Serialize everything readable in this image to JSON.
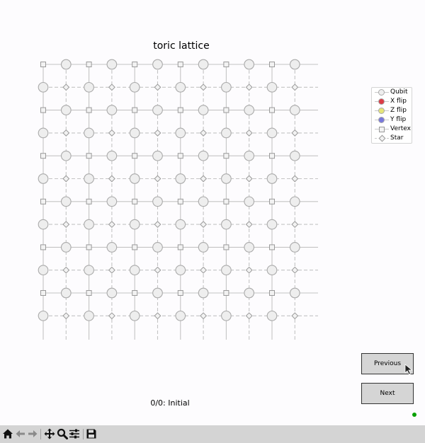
{
  "figure": {
    "title": "toric lattice",
    "status": "0/0: Initial"
  },
  "lattice": {
    "rows": 12,
    "cols": 12
  },
  "legend": {
    "items": [
      {
        "label": "Qubit",
        "marker": "circle",
        "fill": "#eeeeee",
        "line": "solid"
      },
      {
        "label": "X flip",
        "marker": "circle",
        "fill": "#dc3c46",
        "line": "solid"
      },
      {
        "label": "Z flip",
        "marker": "circle",
        "fill": "#e6e678",
        "line": "solid"
      },
      {
        "label": "Y flip",
        "marker": "circle",
        "fill": "#7878dc",
        "line": "solid"
      },
      {
        "label": "Vertex",
        "marker": "square",
        "fill": "#f2f2f2",
        "line": "solid"
      },
      {
        "label": "Star",
        "marker": "diamond",
        "fill": "#f2f2f2",
        "line": "dashed"
      }
    ]
  },
  "buttons": {
    "previous": "Previous",
    "next": "Next"
  },
  "colors": {
    "qubit_fill": "#eeeeee",
    "qubit_stroke": "#aaaaaa",
    "vertex_line": "#c4c4c4",
    "star_line": "#c4c4c4",
    "status_dot": "#08a000"
  },
  "toolbar": {
    "icons": [
      "home-icon",
      "back-icon",
      "forward-icon",
      "pan-icon",
      "zoom-icon",
      "configure-icon",
      "save-icon"
    ]
  }
}
